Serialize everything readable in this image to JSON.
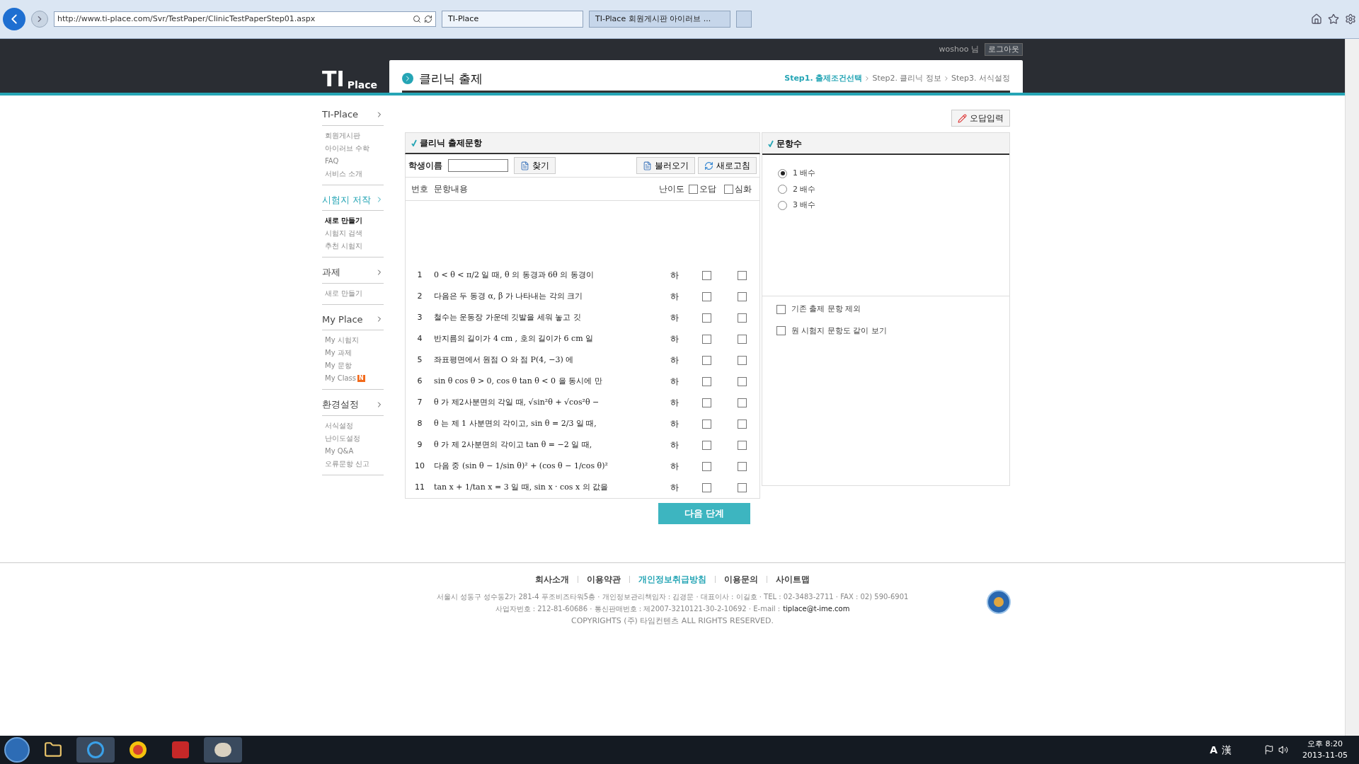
{
  "browser": {
    "url": "http://www.ti-place.com/Svr/TestPaper/ClinicTestPaperStep01.aspx",
    "tabs": [
      {
        "label": "TI-Place",
        "selected": true
      },
      {
        "label": "TI-Place 회원게시판 아이러브 ...",
        "selected": false
      }
    ]
  },
  "header": {
    "user": "woshoo 님",
    "logout": "로그아웃",
    "logo_main": "TI",
    "logo_sub": "Place"
  },
  "page": {
    "title": "클리닉 출제",
    "steps": [
      {
        "label": "Step1. 출제조건선택",
        "selected": true
      },
      {
        "label": "Step2. 클리닉 정보",
        "selected": false
      },
      {
        "label": "Step3. 서식설정",
        "selected": false
      }
    ]
  },
  "sidebar": [
    {
      "title": "TI-Place",
      "selected": false,
      "items": [
        {
          "label": "회원게시판",
          "selected": false
        },
        {
          "label": "아이러브 수학",
          "selected": false
        },
        {
          "label": "FAQ",
          "selected": false
        },
        {
          "label": "서비스 소개",
          "selected": false
        }
      ]
    },
    {
      "title": "시험지 저작",
      "selected": true,
      "items": [
        {
          "label": "새로 만들기",
          "selected": true
        },
        {
          "label": "시험지 검색",
          "selected": false
        },
        {
          "label": "추천 시험지",
          "selected": false
        }
      ]
    },
    {
      "title": "과제",
      "selected": false,
      "items": [
        {
          "label": "새로 만들기",
          "selected": false
        }
      ]
    },
    {
      "title": "My Place",
      "selected": false,
      "items": [
        {
          "label": "My 시험지",
          "selected": false
        },
        {
          "label": "My 과제",
          "selected": false
        },
        {
          "label": "My 문항",
          "selected": false
        },
        {
          "label": "My Class",
          "selected": false,
          "badge": "N"
        }
      ]
    },
    {
      "title": "환경설정",
      "selected": false,
      "items": [
        {
          "label": "서식설정",
          "selected": false
        },
        {
          "label": "난이도설정",
          "selected": false
        },
        {
          "label": "My Q&A",
          "selected": false
        },
        {
          "label": "오류문항 신고",
          "selected": false
        }
      ]
    }
  ],
  "wrong_answer_button": "오답입력",
  "questions_panel": {
    "title": "클리닉 출제문항",
    "student_label": "학생이름",
    "search_button": "찾기",
    "load_button": "불러오기",
    "refresh_button": "새로고침",
    "columns": [
      "번호",
      "문항내용",
      "난이도"
    ],
    "column_checks": [
      {
        "label": "오답",
        "checked": false
      },
      {
        "label": "심화",
        "checked": false
      }
    ],
    "rows": [
      {
        "number": "1",
        "content": "0 < θ < π/2 일 때, θ 의 동경과 6θ 의 동경이",
        "difficulty": "하",
        "wrong": false,
        "advanced": false
      },
      {
        "number": "2",
        "content": "다음은 두 동경 α, β 가 나타내는 각의 크기",
        "difficulty": "하",
        "wrong": false,
        "advanced": false
      },
      {
        "number": "3",
        "content": "철수는 운동장 가운데 깃발을 세워 놓고 깃",
        "difficulty": "하",
        "wrong": false,
        "advanced": false
      },
      {
        "number": "4",
        "content": "반지름의 길이가 4 cm , 호의 길이가 6 cm 일",
        "difficulty": "하",
        "wrong": false,
        "advanced": false
      },
      {
        "number": "5",
        "content": "좌표평면에서 원점 O 와 점 P(4, −3) 에",
        "difficulty": "하",
        "wrong": false,
        "advanced": false
      },
      {
        "number": "6",
        "content": "sin θ cos θ > 0, cos θ tan θ < 0 을 동시에 만",
        "difficulty": "하",
        "wrong": false,
        "advanced": false
      },
      {
        "number": "7",
        "content": "θ 가 제2사분면의 각일 때, √sin²θ + √cos²θ −",
        "difficulty": "하",
        "wrong": false,
        "advanced": false
      },
      {
        "number": "8",
        "content": "θ 는 제 1 사분면의 각이고, sin θ = 2/3 일 때,",
        "difficulty": "하",
        "wrong": false,
        "advanced": false
      },
      {
        "number": "9",
        "content": "θ 가 제 2사분면의 각이고 tan θ = −2 일 때,",
        "difficulty": "하",
        "wrong": false,
        "advanced": false
      },
      {
        "number": "10",
        "content": "다음 중 (sin θ − 1/sin θ)² + (cos θ − 1/cos θ)²",
        "difficulty": "하",
        "wrong": false,
        "advanced": false
      },
      {
        "number": "11",
        "content": "tan x + 1/tan x = 3 일 때, sin x · cos x 의 값을",
        "difficulty": "하",
        "wrong": false,
        "advanced": false
      }
    ]
  },
  "next_button": "다음 단계",
  "count_panel": {
    "title": "문항수",
    "options": [
      {
        "label": "1 배수",
        "selected": true
      },
      {
        "label": "2 배수",
        "selected": false
      },
      {
        "label": "3 배수",
        "selected": false
      }
    ],
    "checks": [
      {
        "label": "기존 출제 문항 제외",
        "checked": false
      },
      {
        "label": "원 시험지 문항도 같이 보기",
        "checked": false
      }
    ]
  },
  "footer": {
    "links": [
      {
        "label": "회사소개",
        "highlighted": false
      },
      {
        "label": "이용약관",
        "highlighted": false
      },
      {
        "label": "개인정보취급방침",
        "highlighted": true
      },
      {
        "label": "이용문의",
        "highlighted": false
      },
      {
        "label": "사이트맵",
        "highlighted": false
      }
    ],
    "address": "서울시 성동구 성수동2가 281-4 푸조비즈타워5층 · 개인정보관리책임자 : 김경문 · 대표이사 : 이길호 · TEL : 02-3483-2711 · FAX : 02) 590-6901",
    "business": "사업자번호 : 212-81-60686 · 통신판매번호 : 제2007-3210121-30-2-10692 · E-mail :",
    "email": "tiplace@t-ime.com",
    "copyright": "COPYRIGHTS (주) 타임컨텐츠 ALL RIGHTS RESERVED."
  },
  "taskbar": {
    "ime_mode": "A",
    "ime_hanja": "漢",
    "time": "오후 8:20",
    "date": "2013-11-05"
  }
}
